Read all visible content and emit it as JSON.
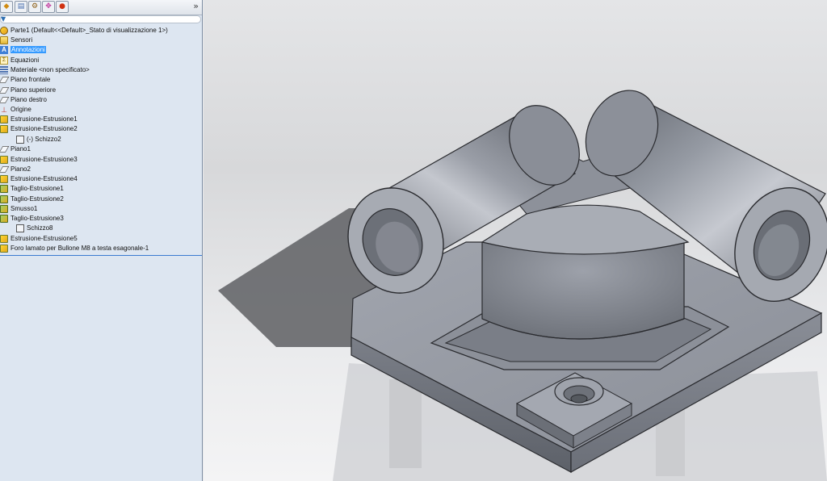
{
  "panel": {
    "tabs": [
      {
        "icon": "feature-manager-icon"
      },
      {
        "icon": "property-manager-icon"
      },
      {
        "icon": "configuration-manager-icon"
      },
      {
        "icon": "dimxpert-icon"
      },
      {
        "icon": "display-manager-icon"
      }
    ],
    "expand_label": "»",
    "filter_icon": "filter-icon"
  },
  "tree": {
    "root": "Parte1  (Default<<Default>_Stato di visualizzazione 1>)",
    "items": [
      {
        "label": "Sensori",
        "icon": "sensor-folder-icon"
      },
      {
        "label": "Annotazioni",
        "icon": "annotations-icon",
        "selected": true
      },
      {
        "label": "Equazioni",
        "icon": "equations-icon"
      },
      {
        "label": "Materiale <non specificato>",
        "icon": "material-icon"
      },
      {
        "label": "Piano frontale",
        "icon": "plane-icon"
      },
      {
        "label": "Piano superiore",
        "icon": "plane-icon"
      },
      {
        "label": "Piano destro",
        "icon": "plane-icon"
      },
      {
        "label": "Origine",
        "icon": "origin-icon"
      },
      {
        "label": "Estrusione-Estrusione1",
        "icon": "extrude-icon"
      },
      {
        "label": "Estrusione-Estrusione2",
        "icon": "extrude-icon"
      },
      {
        "label": "(-) Schizzo2",
        "icon": "sketch-icon",
        "child": true
      },
      {
        "label": "Piano1",
        "icon": "plane-icon"
      },
      {
        "label": "Estrusione-Estrusione3",
        "icon": "extrude-icon"
      },
      {
        "label": "Piano2",
        "icon": "plane-icon"
      },
      {
        "label": "Estrusione-Estrusione4",
        "icon": "extrude-icon"
      },
      {
        "label": "Taglio-Estrusione1",
        "icon": "cut-extrude-icon"
      },
      {
        "label": "Taglio-Estrusione2",
        "icon": "cut-extrude-icon"
      },
      {
        "label": "Smusso1",
        "icon": "chamfer-icon"
      },
      {
        "label": "Taglio-Estrusione3",
        "icon": "cut-extrude-icon"
      },
      {
        "label": "Schizzo8",
        "icon": "sketch-icon",
        "child": true
      },
      {
        "label": "Estrusione-Estrusione5",
        "icon": "extrude-icon"
      },
      {
        "label": "Foro lamato per Bullone M8 a testa esagonale-1",
        "icon": "hole-wizard-icon"
      }
    ]
  },
  "viewport": {
    "model": "3d-part-model",
    "colors": {
      "part": "#8e929c",
      "part_light": "#b9bcc4",
      "part_dark": "#5c6068",
      "shadow": "#6b6c70"
    }
  }
}
